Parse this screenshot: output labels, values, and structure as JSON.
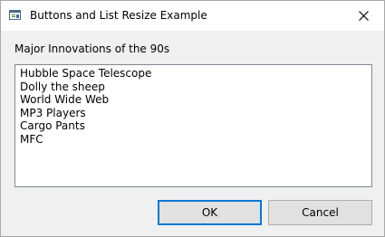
{
  "window": {
    "title": "Buttons and List Resize Example",
    "icon": "app-window-icon",
    "close_icon": "close-icon"
  },
  "main": {
    "group_label": "Major Innovations of the 90s",
    "list_items": [
      "Hubble Space Telescope",
      "Dolly the sheep",
      "World Wide Web",
      "MP3 Players",
      "Cargo Pants",
      "MFC"
    ]
  },
  "buttons": {
    "ok_label": "OK",
    "cancel_label": "Cancel"
  },
  "colors": {
    "focus_accent": "#0078d7",
    "button_face": "#e1e1e1",
    "dialog_background": "#f0f0f0"
  }
}
